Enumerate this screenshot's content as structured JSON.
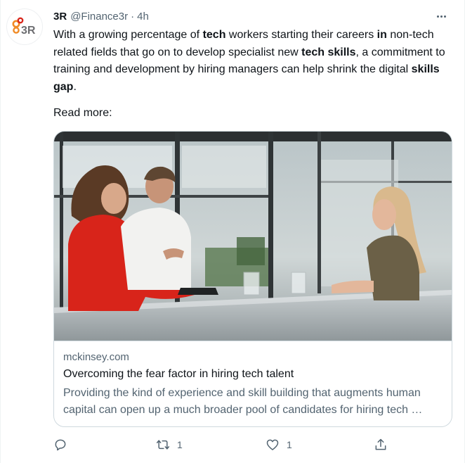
{
  "author": {
    "name": "3R",
    "handle": "@Finance3r",
    "separator": "·",
    "time": "4h",
    "avatar_text": "3R"
  },
  "tweet": {
    "segments": [
      {
        "t": "With a growing percentage of ",
        "b": false
      },
      {
        "t": "tech",
        "b": true
      },
      {
        "t": " workers starting their careers ",
        "b": false
      },
      {
        "t": "in",
        "b": true
      },
      {
        "t": " non-tech related fields that go on to develop specialist new ",
        "b": false
      },
      {
        "t": "tech skills",
        "b": true
      },
      {
        "t": ", a commitment to training and development by hiring managers can help shrink the digital ",
        "b": false
      },
      {
        "t": "skills gap",
        "b": true
      },
      {
        "t": ".",
        "b": false
      }
    ],
    "read_more": "Read more:"
  },
  "card": {
    "domain": "mckinsey.com",
    "title": "Overcoming the fear factor in hiring tech talent",
    "description": "Providing the kind of experience and skill building that augments human capital can open up a much broader pool of candidates for hiring tech …"
  },
  "actions": {
    "reply": {
      "icon": "reply-icon"
    },
    "retweet": {
      "icon": "retweet-icon",
      "count": "1"
    },
    "like": {
      "icon": "heart-icon",
      "count": "1"
    },
    "share": {
      "icon": "share-icon"
    }
  },
  "colors": {
    "text_primary": "#0f1419",
    "text_secondary": "#536471",
    "border": "#cfd9de",
    "logo_orange": "#f08a24",
    "logo_red": "#d9261c",
    "logo_gray": "#6d6e71"
  }
}
